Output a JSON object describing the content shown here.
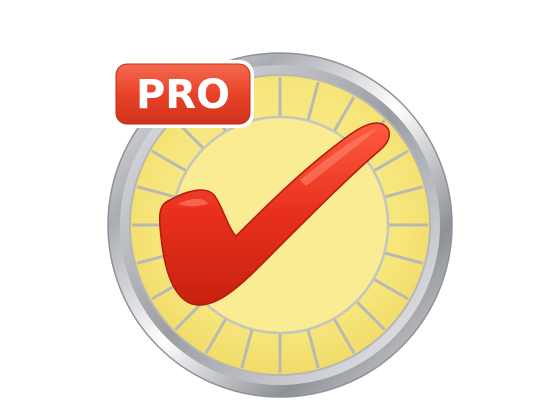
{
  "app_icon": {
    "name": "checkmark-pro-app-icon",
    "badge_label": "PRO",
    "colors": {
      "background": "#ffffff",
      "dial_fill": "#f6e57a",
      "dial_inner": "#f9ec93",
      "ring_silver": "#c9cbcf",
      "ring_dark": "#8e9197",
      "segment_lines": "#b8b9b4",
      "check_red": "#e8301c",
      "badge_red": "#e8432a",
      "badge_text": "#ffffff"
    }
  }
}
